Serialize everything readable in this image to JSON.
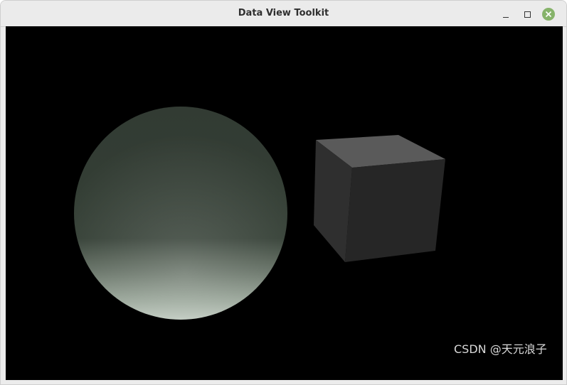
{
  "window": {
    "title": "Data View Toolkit",
    "controls": {
      "minimize_icon": "minimize-icon",
      "maximize_icon": "maximize-icon",
      "close_icon": "close-icon",
      "close_color": "#86b36a"
    }
  },
  "scene": {
    "background": "#000000",
    "objects": [
      {
        "type": "sphere",
        "shading": "gradient",
        "colors": [
          "#313a31",
          "#a7b6a8"
        ]
      },
      {
        "type": "cube",
        "shading": "flat",
        "colors": [
          "#5a5a5a",
          "#2f2f2f",
          "#262626"
        ]
      }
    ]
  },
  "watermark": {
    "text": "CSDN @天元浪子"
  }
}
